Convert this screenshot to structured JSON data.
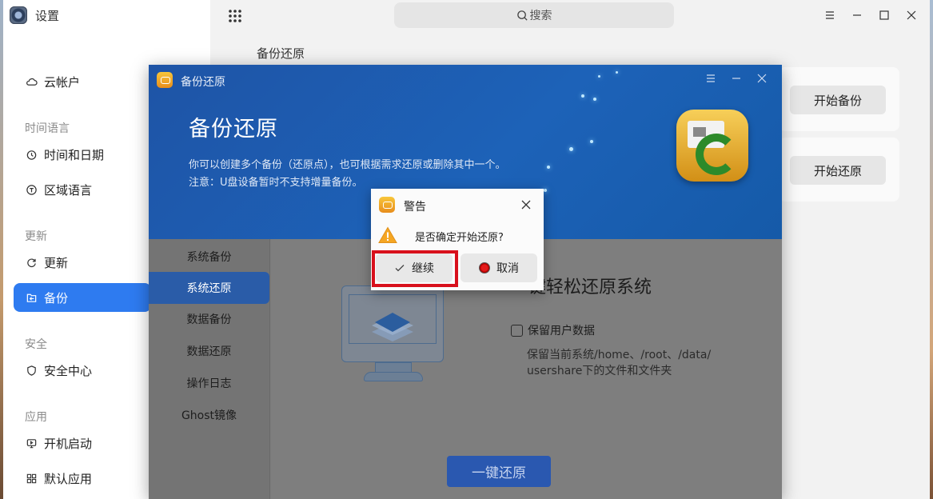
{
  "settings": {
    "app_title": "设置",
    "search_placeholder": "搜索",
    "breadcrumb": "备份还原",
    "sidebar": [
      {
        "group": "",
        "items": [
          {
            "label": "云帐户",
            "icon": "cloud-icon"
          }
        ]
      },
      {
        "group": "时间语言",
        "items": [
          {
            "label": "时间和日期",
            "icon": "clock-icon"
          },
          {
            "label": "区域语言",
            "icon": "language-icon"
          }
        ]
      },
      {
        "group": "更新",
        "items": [
          {
            "label": "更新",
            "icon": "refresh-icon"
          },
          {
            "label": "备份",
            "icon": "backup-icon",
            "active": true
          }
        ]
      },
      {
        "group": "安全",
        "items": [
          {
            "label": "安全中心",
            "icon": "shield-icon"
          }
        ]
      },
      {
        "group": "应用",
        "items": [
          {
            "label": "开机启动",
            "icon": "startup-icon"
          },
          {
            "label": "默认应用",
            "icon": "apps-grid-icon"
          }
        ]
      }
    ],
    "panels": {
      "start_backup": "开始备份",
      "start_restore": "开始还原"
    }
  },
  "backup_app": {
    "title": "备份还原",
    "heading": "备份还原",
    "desc_line1": "你可以创建多个备份（还原点），也可根据需求还原或删除其中一个。",
    "desc_line2": "注意：U盘设备暂时不支持增量备份。",
    "nav": [
      "系统备份",
      "系统还原",
      "数据备份",
      "数据还原",
      "操作日志",
      "Ghost镜像"
    ],
    "active_nav": "系统还原",
    "main_heading": "键轻松还原系统",
    "keep_user_data_label": "保留用户数据",
    "keep_user_data_checked": false,
    "hint_line1": "保留当前系统/home、/root、/data/",
    "hint_line2": "usershare下的文件和文件夹",
    "one_click_button": "一键还原"
  },
  "dialog": {
    "title": "警告",
    "message": "是否确定开始还原?",
    "continue_label": "继续",
    "cancel_label": "取消"
  },
  "colors": {
    "accent": "#2e7bf0",
    "highlight": "#d8101c",
    "banner": "#1d62b8"
  }
}
